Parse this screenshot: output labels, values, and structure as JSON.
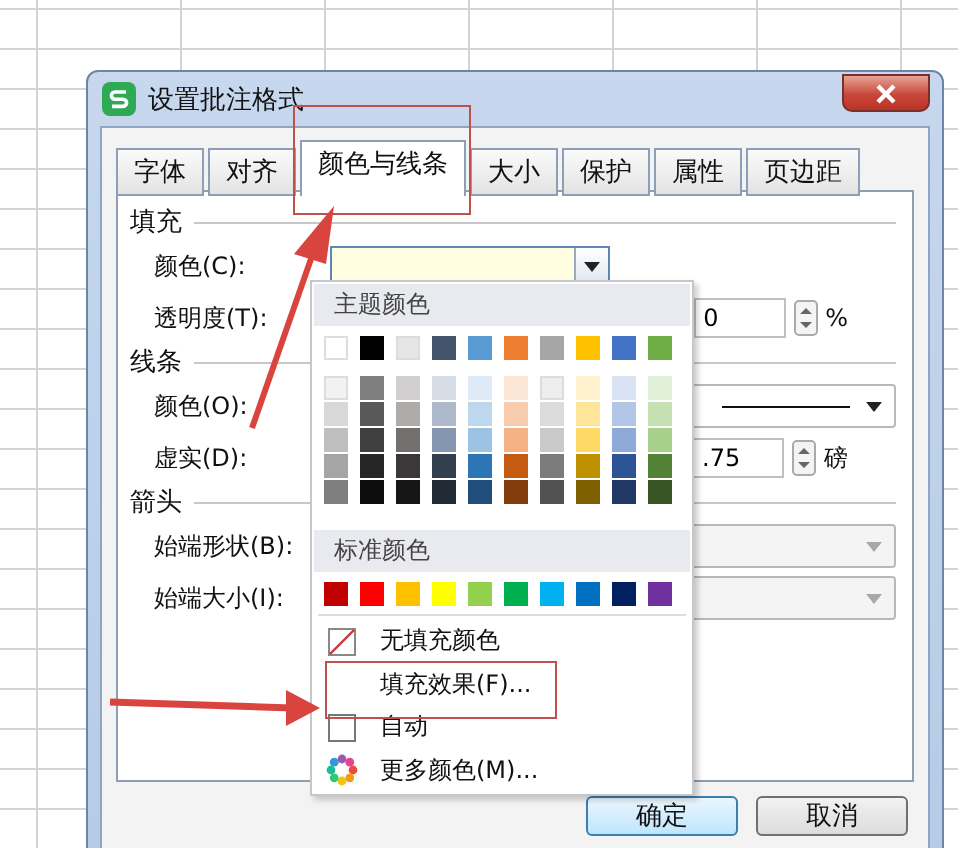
{
  "window": {
    "title": "设置批注格式"
  },
  "tabs": [
    {
      "label": "字体",
      "selected": false
    },
    {
      "label": "对齐",
      "selected": false
    },
    {
      "label": "颜色与线条",
      "selected": true
    },
    {
      "label": "大小",
      "selected": false
    },
    {
      "label": "保护",
      "selected": false
    },
    {
      "label": "属性",
      "selected": false
    },
    {
      "label": "页边距",
      "selected": false
    }
  ],
  "sections": [
    {
      "title": "填充",
      "rows": [
        {
          "kind": "color",
          "label": "颜色(C):",
          "color": "#fffee0"
        },
        {
          "kind": "spin",
          "label": "透明度(T):",
          "value": "0",
          "unit": "%"
        }
      ]
    },
    {
      "title": "线条",
      "rows": [
        {
          "kind": "line",
          "label": "颜色(O):"
        },
        {
          "kind": "spin",
          "label": "虚实(D):",
          "value": ".75",
          "unit": "磅"
        }
      ]
    },
    {
      "title": "箭头",
      "rows": [
        {
          "kind": "select",
          "label": "始端形状(B):",
          "disabled": true
        },
        {
          "kind": "select",
          "label": "始端大小(I):",
          "disabled": true
        }
      ]
    }
  ],
  "color_menu": {
    "theme_title": "主题颜色",
    "theme_colors": [
      {
        "color": "#ffffff"
      },
      {
        "color": "#000000"
      },
      {
        "color": "#e7e6e6"
      },
      {
        "color": "#44546a"
      },
      {
        "color": "#5b9bd5"
      },
      {
        "color": "#ed7d31"
      },
      {
        "color": "#a5a5a5"
      },
      {
        "color": "#ffc000"
      },
      {
        "color": "#4472c4"
      },
      {
        "color": "#70ad47"
      }
    ],
    "shades": [
      [
        {
          "color": "#f2f2f2"
        },
        {
          "color": "#7f7f7f"
        },
        {
          "color": "#d0cece"
        },
        {
          "color": "#d6dce4"
        },
        {
          "color": "#deebf6"
        },
        {
          "color": "#fbe5d5"
        },
        {
          "color": "#ededed"
        },
        {
          "color": "#fff2cc"
        },
        {
          "color": "#d9e2f3"
        },
        {
          "color": "#e2efd9"
        }
      ],
      [
        {
          "color": "#d8d8d8"
        },
        {
          "color": "#595959"
        },
        {
          "color": "#aeabab"
        },
        {
          "color": "#adb9ca"
        },
        {
          "color": "#bdd7ee"
        },
        {
          "color": "#f7cbac"
        },
        {
          "color": "#dbdbdb"
        },
        {
          "color": "#fee599"
        },
        {
          "color": "#b4c6e7"
        },
        {
          "color": "#c5e0b3"
        }
      ],
      [
        {
          "color": "#bfbfbf"
        },
        {
          "color": "#3f3f3f"
        },
        {
          "color": "#757070"
        },
        {
          "color": "#8496b0"
        },
        {
          "color": "#9cc3e5"
        },
        {
          "color": "#f4b183"
        },
        {
          "color": "#c9c9c9"
        },
        {
          "color": "#ffd965"
        },
        {
          "color": "#8eaadb"
        },
        {
          "color": "#a8d08d"
        }
      ],
      [
        {
          "color": "#a5a5a5"
        },
        {
          "color": "#262626"
        },
        {
          "color": "#3a3838"
        },
        {
          "color": "#323f4f"
        },
        {
          "color": "#2e75b5"
        },
        {
          "color": "#c55a11"
        },
        {
          "color": "#7b7b7b"
        },
        {
          "color": "#bf9000"
        },
        {
          "color": "#2f5496"
        },
        {
          "color": "#538135"
        }
      ],
      [
        {
          "color": "#7f7f7f"
        },
        {
          "color": "#0c0c0c"
        },
        {
          "color": "#171616"
        },
        {
          "color": "#222a35"
        },
        {
          "color": "#1e4e79"
        },
        {
          "color": "#833c0b"
        },
        {
          "color": "#525252"
        },
        {
          "color": "#7f6000"
        },
        {
          "color": "#1f3864"
        },
        {
          "color": "#375623"
        }
      ]
    ],
    "standard_title": "标准颜色",
    "standard_colors": [
      {
        "color": "#c00000"
      },
      {
        "color": "#ff0000"
      },
      {
        "color": "#ffc000"
      },
      {
        "color": "#ffff00"
      },
      {
        "color": "#92d050"
      },
      {
        "color": "#00b050"
      },
      {
        "color": "#00b0f0"
      },
      {
        "color": "#0070c0"
      },
      {
        "color": "#002060"
      },
      {
        "color": "#7030a0"
      }
    ],
    "items": [
      {
        "kind": "none",
        "label": "无填充颜色"
      },
      {
        "kind": "effect",
        "label": "填充效果(F)..."
      },
      {
        "kind": "auto",
        "label": "自动"
      },
      {
        "kind": "more",
        "label": "更多颜色(M)..."
      }
    ]
  },
  "buttons": [
    {
      "label": "确定",
      "default": true
    },
    {
      "label": "取消",
      "default": false
    }
  ]
}
